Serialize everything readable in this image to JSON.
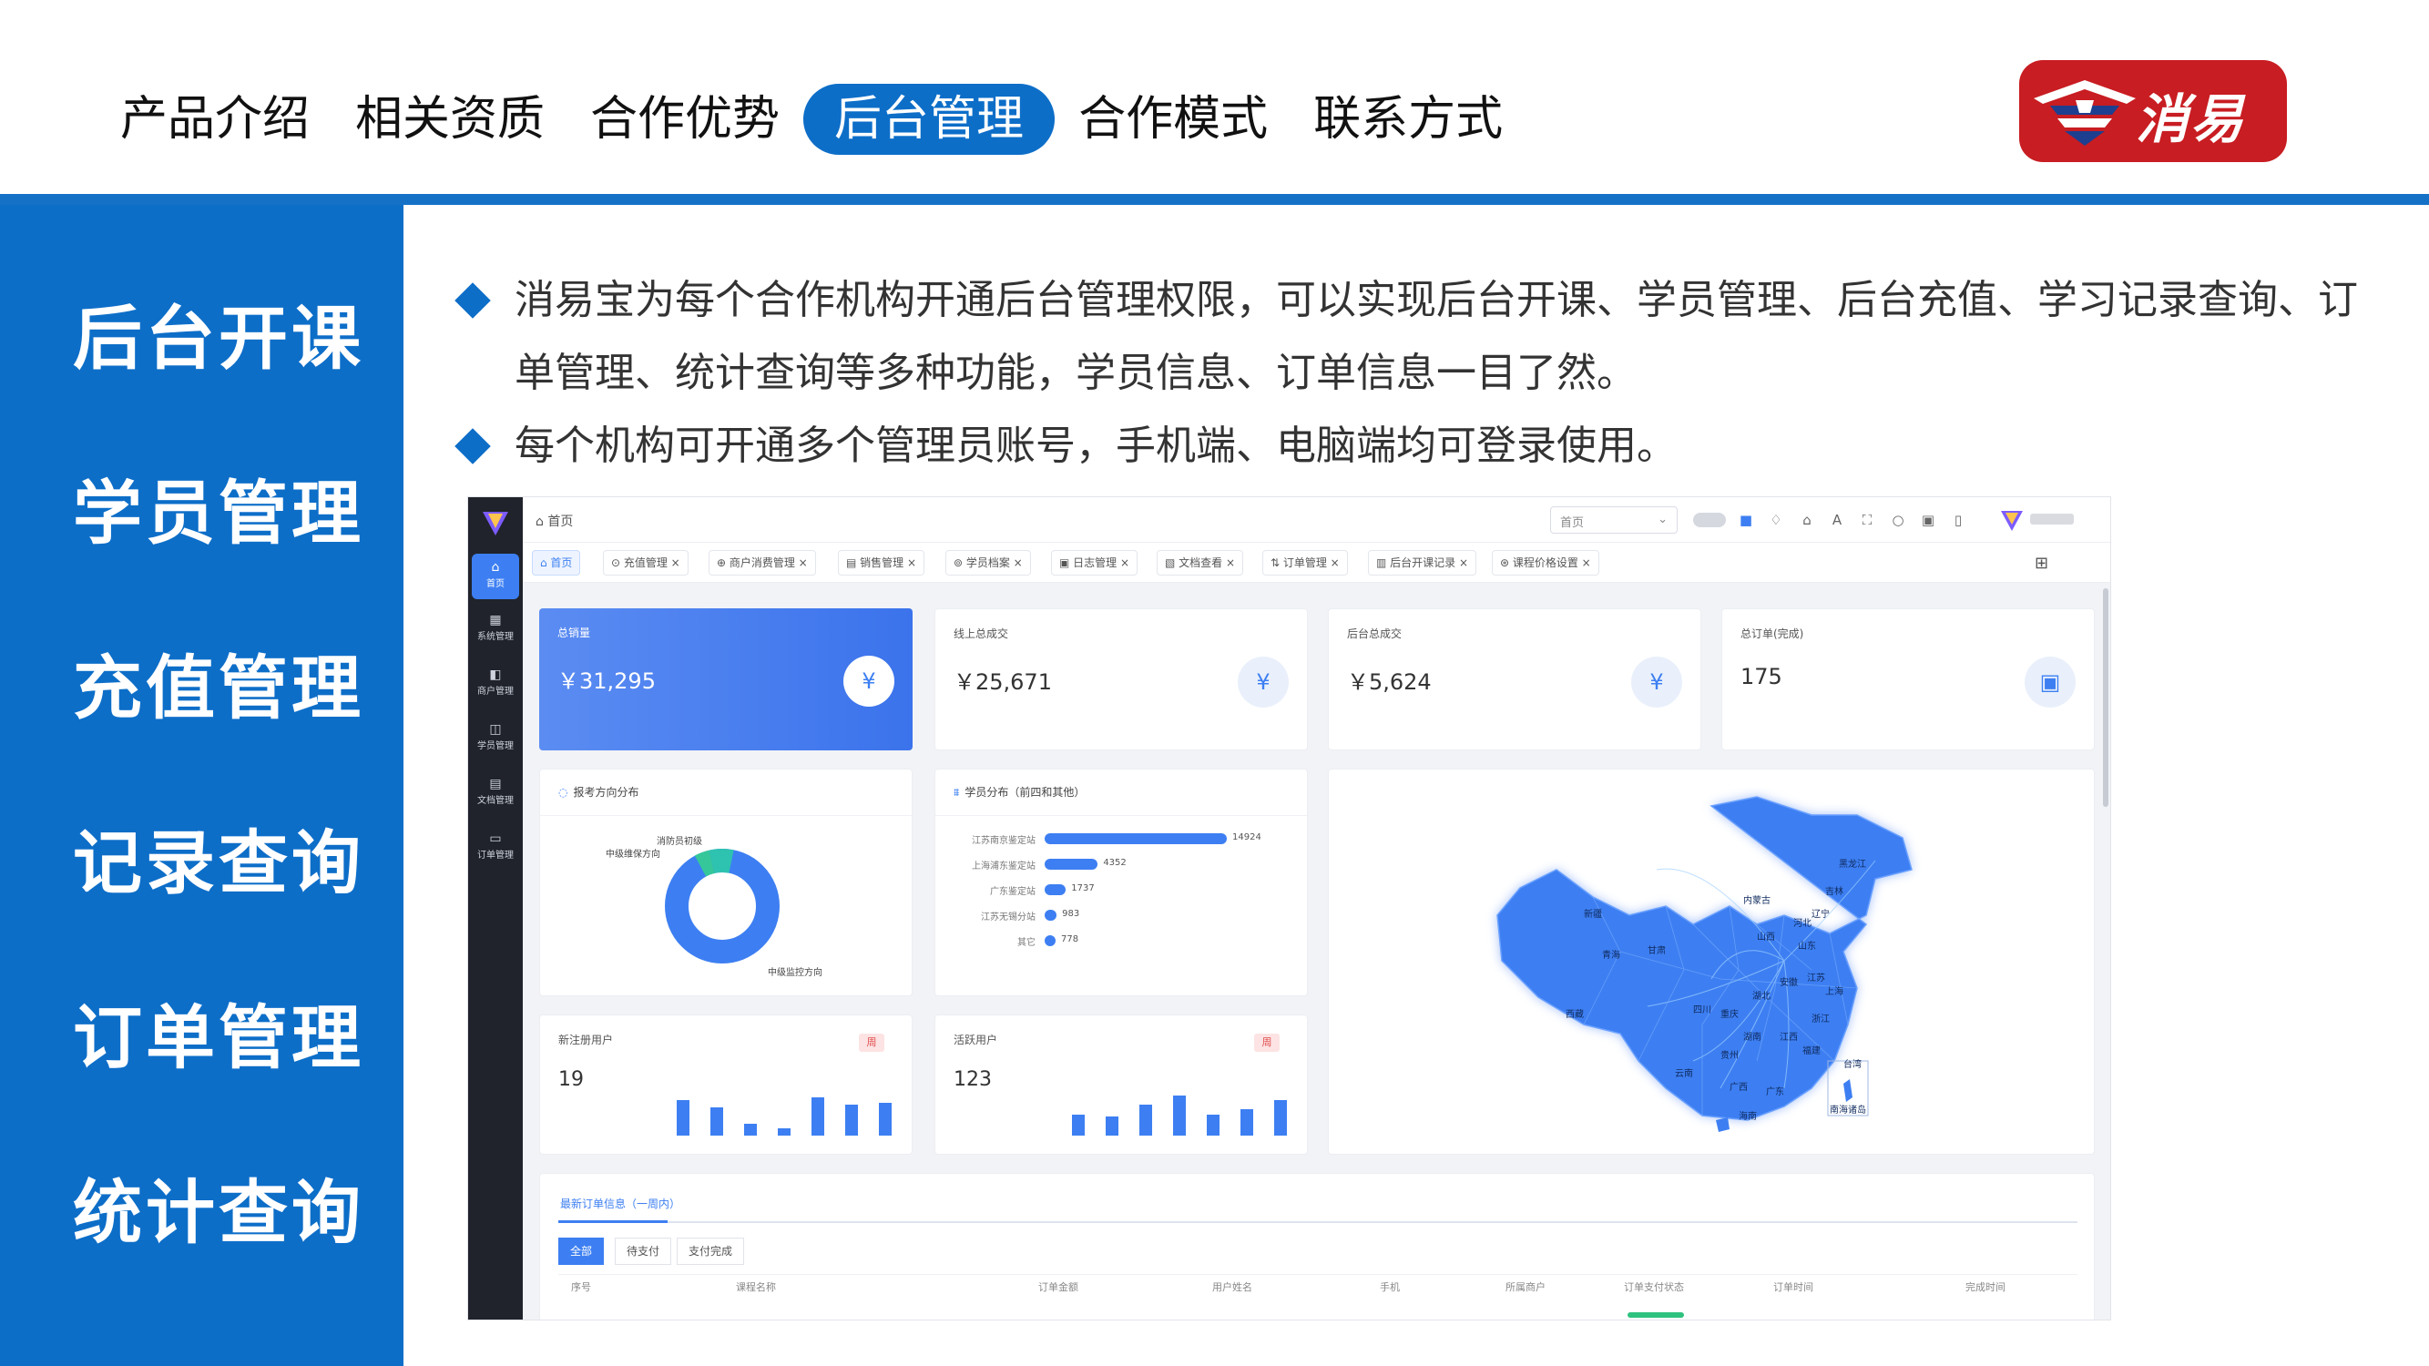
{
  "nav": {
    "tabs": [
      "产品介绍",
      "相关资质",
      "合作优势",
      "后台管理",
      "合作模式",
      "联系方式"
    ],
    "active_index": 3
  },
  "logo": {
    "text": "消易宝"
  },
  "sidebar": {
    "items": [
      "后台开课",
      "学员管理",
      "充值管理",
      "记录查询",
      "订单管理",
      "统计查询"
    ]
  },
  "bullets": [
    "消易宝为每个合作机构开通后台管理权限，可以实现后台开课、学员管理、后台充值、学习记录查询、订单管理、统计查询等多种功能，学员信息、订单信息一目了然。",
    "每个机构可开通多个管理员账号，手机端、电脑端均可登录使用。"
  ],
  "screenshot": {
    "side_menu": [
      {
        "icon": "⌂",
        "label": "首页"
      },
      {
        "icon": "▦",
        "label": "系统管理"
      },
      {
        "icon": "◧",
        "label": "商户管理"
      },
      {
        "icon": "◫",
        "label": "学员管理"
      },
      {
        "icon": "▤",
        "label": "文档管理"
      },
      {
        "icon": "▭",
        "label": "订单管理"
      }
    ],
    "breadcrumb": "⌂ 首页",
    "select_value": "首页",
    "tabs": [
      "⌂ 首页",
      "⊙ 充值管理 ×",
      "⊕ 商户消费管理 ×",
      "▤ 销售管理 ×",
      "⊚ 学员档案 ×",
      "▣ 日志管理 ×",
      "▧ 文档查看 ×",
      "⇅ 订单管理 ×",
      "▥ 后台开课记录 ×",
      "⊛ 课程价格设置 ×"
    ],
    "stats": [
      {
        "title": "总销量",
        "value": "￥31,295",
        "icon": "¥"
      },
      {
        "title": "线上总成交",
        "value": "￥25,671",
        "icon": "¥"
      },
      {
        "title": "后台总成交",
        "value": "￥5,624",
        "icon": "¥"
      },
      {
        "title": "总订单(完成)",
        "value": "175",
        "icon": "▣"
      }
    ],
    "donut": {
      "title": "报考方向分布",
      "labels": [
        "消防员初级",
        "中级维保方向",
        "中级监控方向"
      ]
    },
    "students": {
      "title": "学员分布（前四和其他）",
      "rows": [
        {
          "name": "江苏南京鉴定站",
          "value": 14924
        },
        {
          "name": "上海浦东鉴定站",
          "value": 4352
        },
        {
          "name": "广东鉴定站",
          "value": 1737
        },
        {
          "name": "江苏无锡分站",
          "value": 983
        },
        {
          "name": "其它",
          "value": 778
        }
      ]
    },
    "new_users": {
      "title": "新注册用户",
      "value": "19",
      "badge": "周",
      "bars": [
        0.75,
        0.6,
        0.25,
        0.15,
        0.8,
        0.65,
        0.7
      ]
    },
    "active_users": {
      "title": "活跃用户",
      "value": "123",
      "badge": "周",
      "bars": [
        0.45,
        0.4,
        0.65,
        0.85,
        0.45,
        0.55,
        0.75
      ]
    },
    "map": {
      "labels": [
        "黑龙江",
        "吉林",
        "辽宁",
        "内蒙古",
        "新疆",
        "青海",
        "西藏",
        "甘肃",
        "山西",
        "河北",
        "山东",
        "江苏",
        "上海",
        "浙江",
        "安徽",
        "湖北",
        "四川",
        "重庆",
        "湖南",
        "江西",
        "福建",
        "贵州",
        "云南",
        "广西",
        "广东",
        "海南",
        "台湾",
        "南海诸岛"
      ]
    },
    "orders": {
      "title": "最新订单信息（一周内）",
      "filters": [
        "全部",
        "待支付",
        "支付完成"
      ],
      "columns": [
        "序号",
        "课程名称",
        "订单金额",
        "用户姓名",
        "手机",
        "所属商户",
        "订单支付状态",
        "订单时间",
        "完成时间"
      ]
    }
  }
}
